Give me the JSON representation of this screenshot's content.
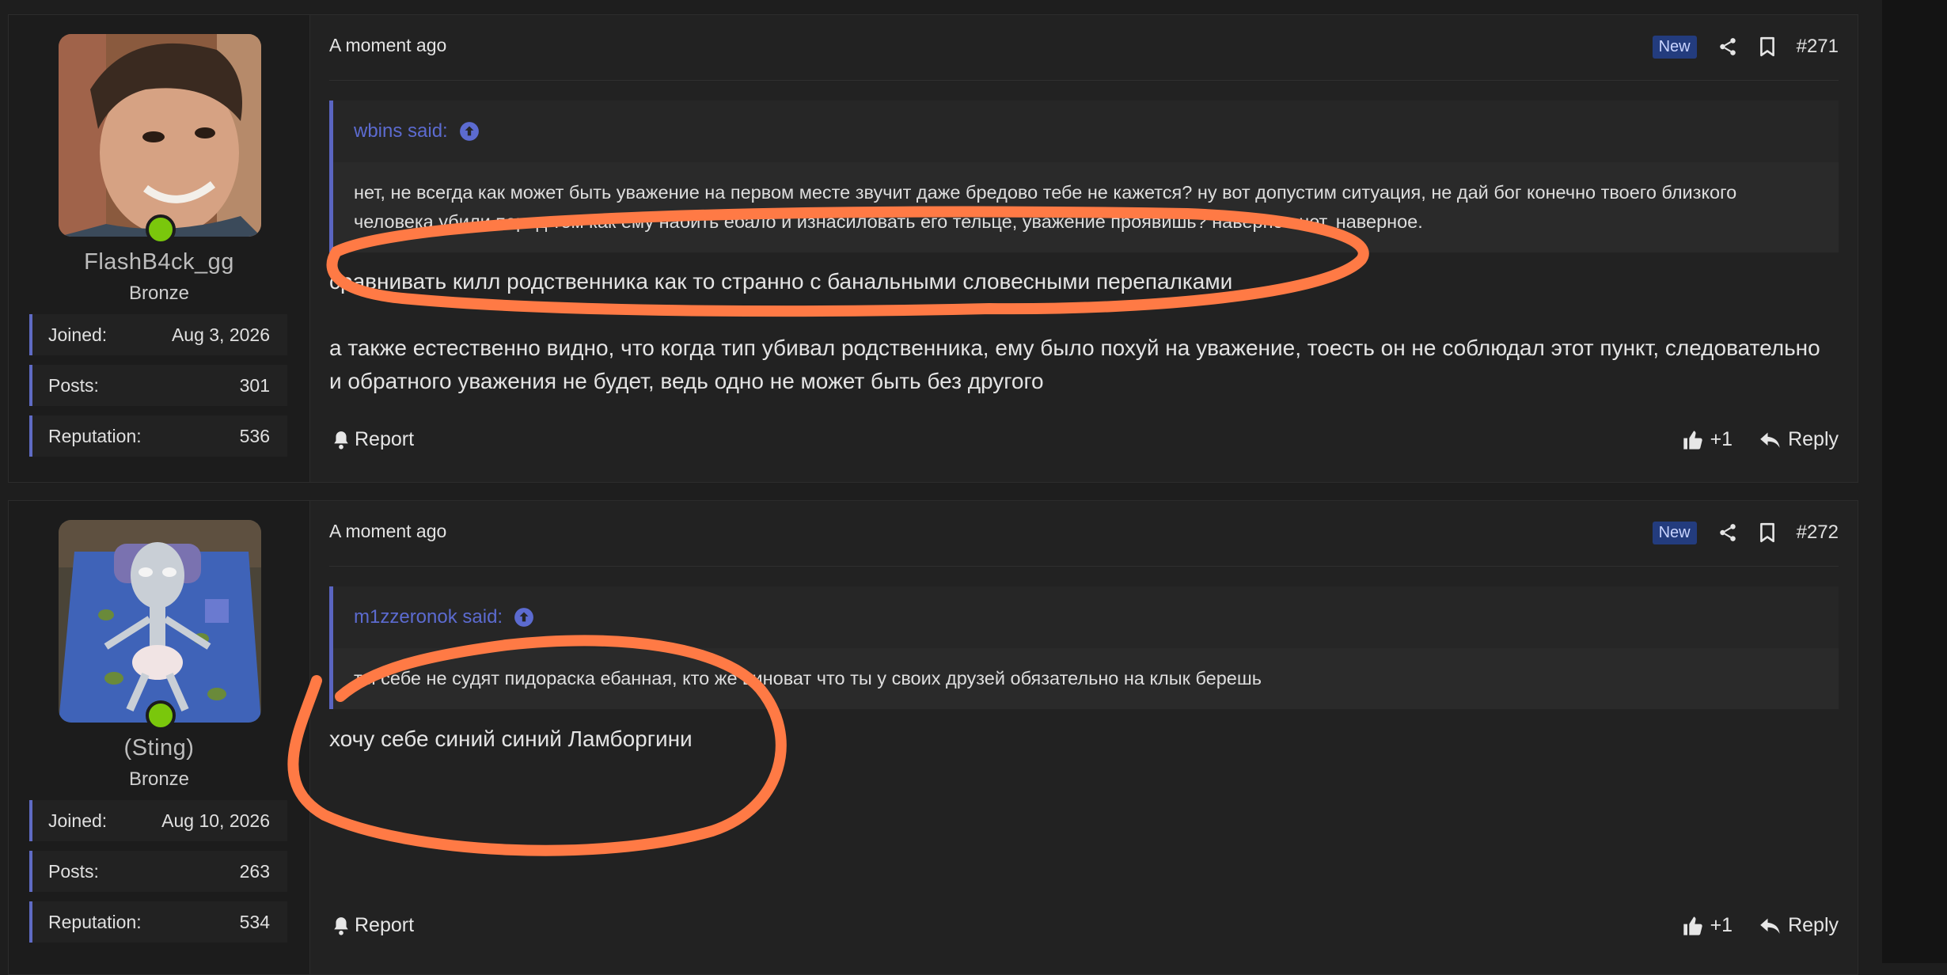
{
  "posts": [
    {
      "user": {
        "name": "FlashB4ck_gg",
        "rank": "Bronze",
        "stats": [
          {
            "label": "Joined:",
            "value": "Aug 3, 2026"
          },
          {
            "label": "Posts:",
            "value": "301"
          },
          {
            "label": "Reputation:",
            "value": "536"
          }
        ]
      },
      "time": "A moment ago",
      "badge": "New",
      "number": "#271",
      "quote": {
        "author": "wbins said:",
        "text": "нет, не всегда как может быть уважение на первом месте звучит даже бредово тебе не кажется? ну вот допустим ситуация, не дай бог конечно твоего близкого человека убили перед тем как ему набить ебало и изнасиловать его тельце, уважение проявишь? наверное нет, наверное."
      },
      "paragraphs": [
        "сравнивать килл родственника как то странно с банальными словесными перепалками",
        "а также естественно видно, что когда тип убивал родственника, ему было похуй на уважение, тоесть он не соблюдал этот пункт, следовательно и обратного уважения не будет, ведь одно не может быть без другого"
      ],
      "report": "Report",
      "like": "+1",
      "reply": "Reply"
    },
    {
      "user": {
        "name": "(Sting)",
        "rank": "Bronze",
        "stats": [
          {
            "label": "Joined:",
            "value": "Aug 10, 2026"
          },
          {
            "label": "Posts:",
            "value": "263"
          },
          {
            "label": "Reputation:",
            "value": "534"
          }
        ]
      },
      "time": "A moment ago",
      "badge": "New",
      "number": "#272",
      "quote": {
        "author": "m1zzeronok said:",
        "text": "ты себе не судят пидораска ебанная, кто же виноват что ты у своих друзей обязательно на клык берешь"
      },
      "paragraphs": [
        "хочу себе синий синий Ламборгини"
      ],
      "report": "Report",
      "like": "+1",
      "reply": "Reply"
    }
  ],
  "colors": {
    "accent": "#5a65c1",
    "online": "#7ac70c",
    "annotation": "#ff7a45",
    "badge": "#233c7e"
  }
}
